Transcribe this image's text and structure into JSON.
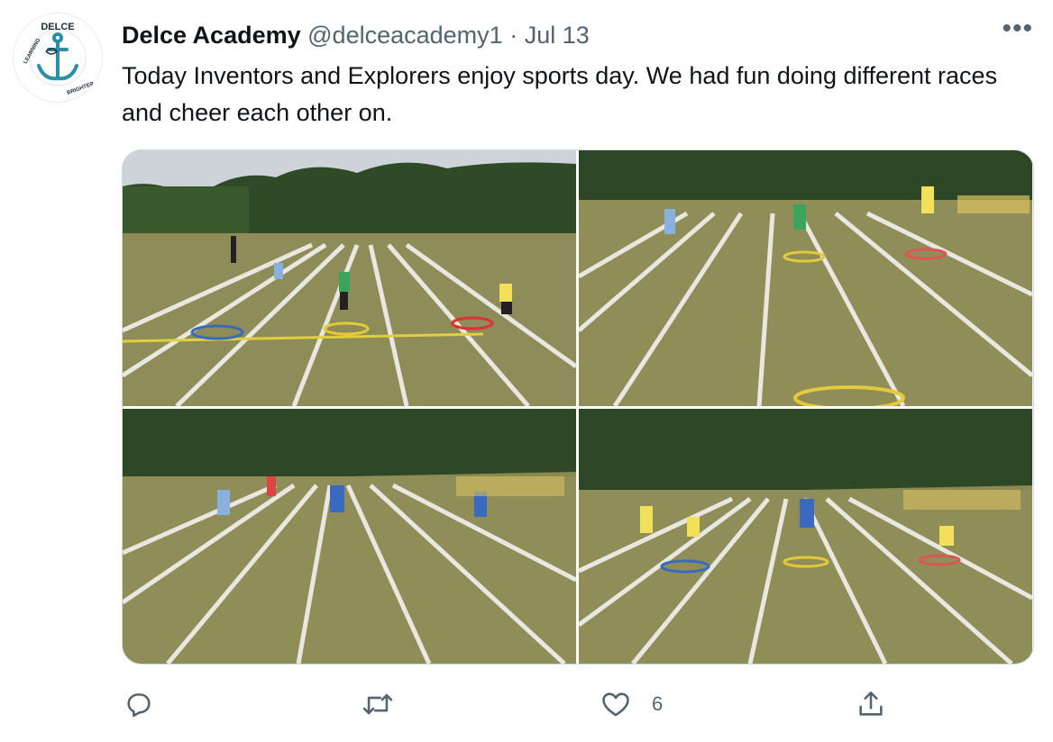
{
  "tweet": {
    "author_name": "Delce Academy",
    "handle": "@delceacademy1",
    "separator": "·",
    "date": "Jul 13",
    "text": "Today Inventors and Explorers enjoy sports day. We had fun doing different races and cheer each other on.",
    "more_label": "•••"
  },
  "avatar": {
    "logo_text_top": "DELCE",
    "logo_text_ring": "LEARNING TOWARDS A BRIGHTER FUTURE"
  },
  "actions": {
    "reply_icon": "reply-icon",
    "retweet_icon": "retweet-icon",
    "like_icon": "heart-icon",
    "like_count": "6",
    "share_icon": "share-icon"
  },
  "media": {
    "photo_count": 4
  },
  "colors": {
    "text": "#0f1419",
    "secondary": "#536471",
    "border": "#cfd9de",
    "grass": "#8a8a4e",
    "trees": "#2f4a26"
  }
}
